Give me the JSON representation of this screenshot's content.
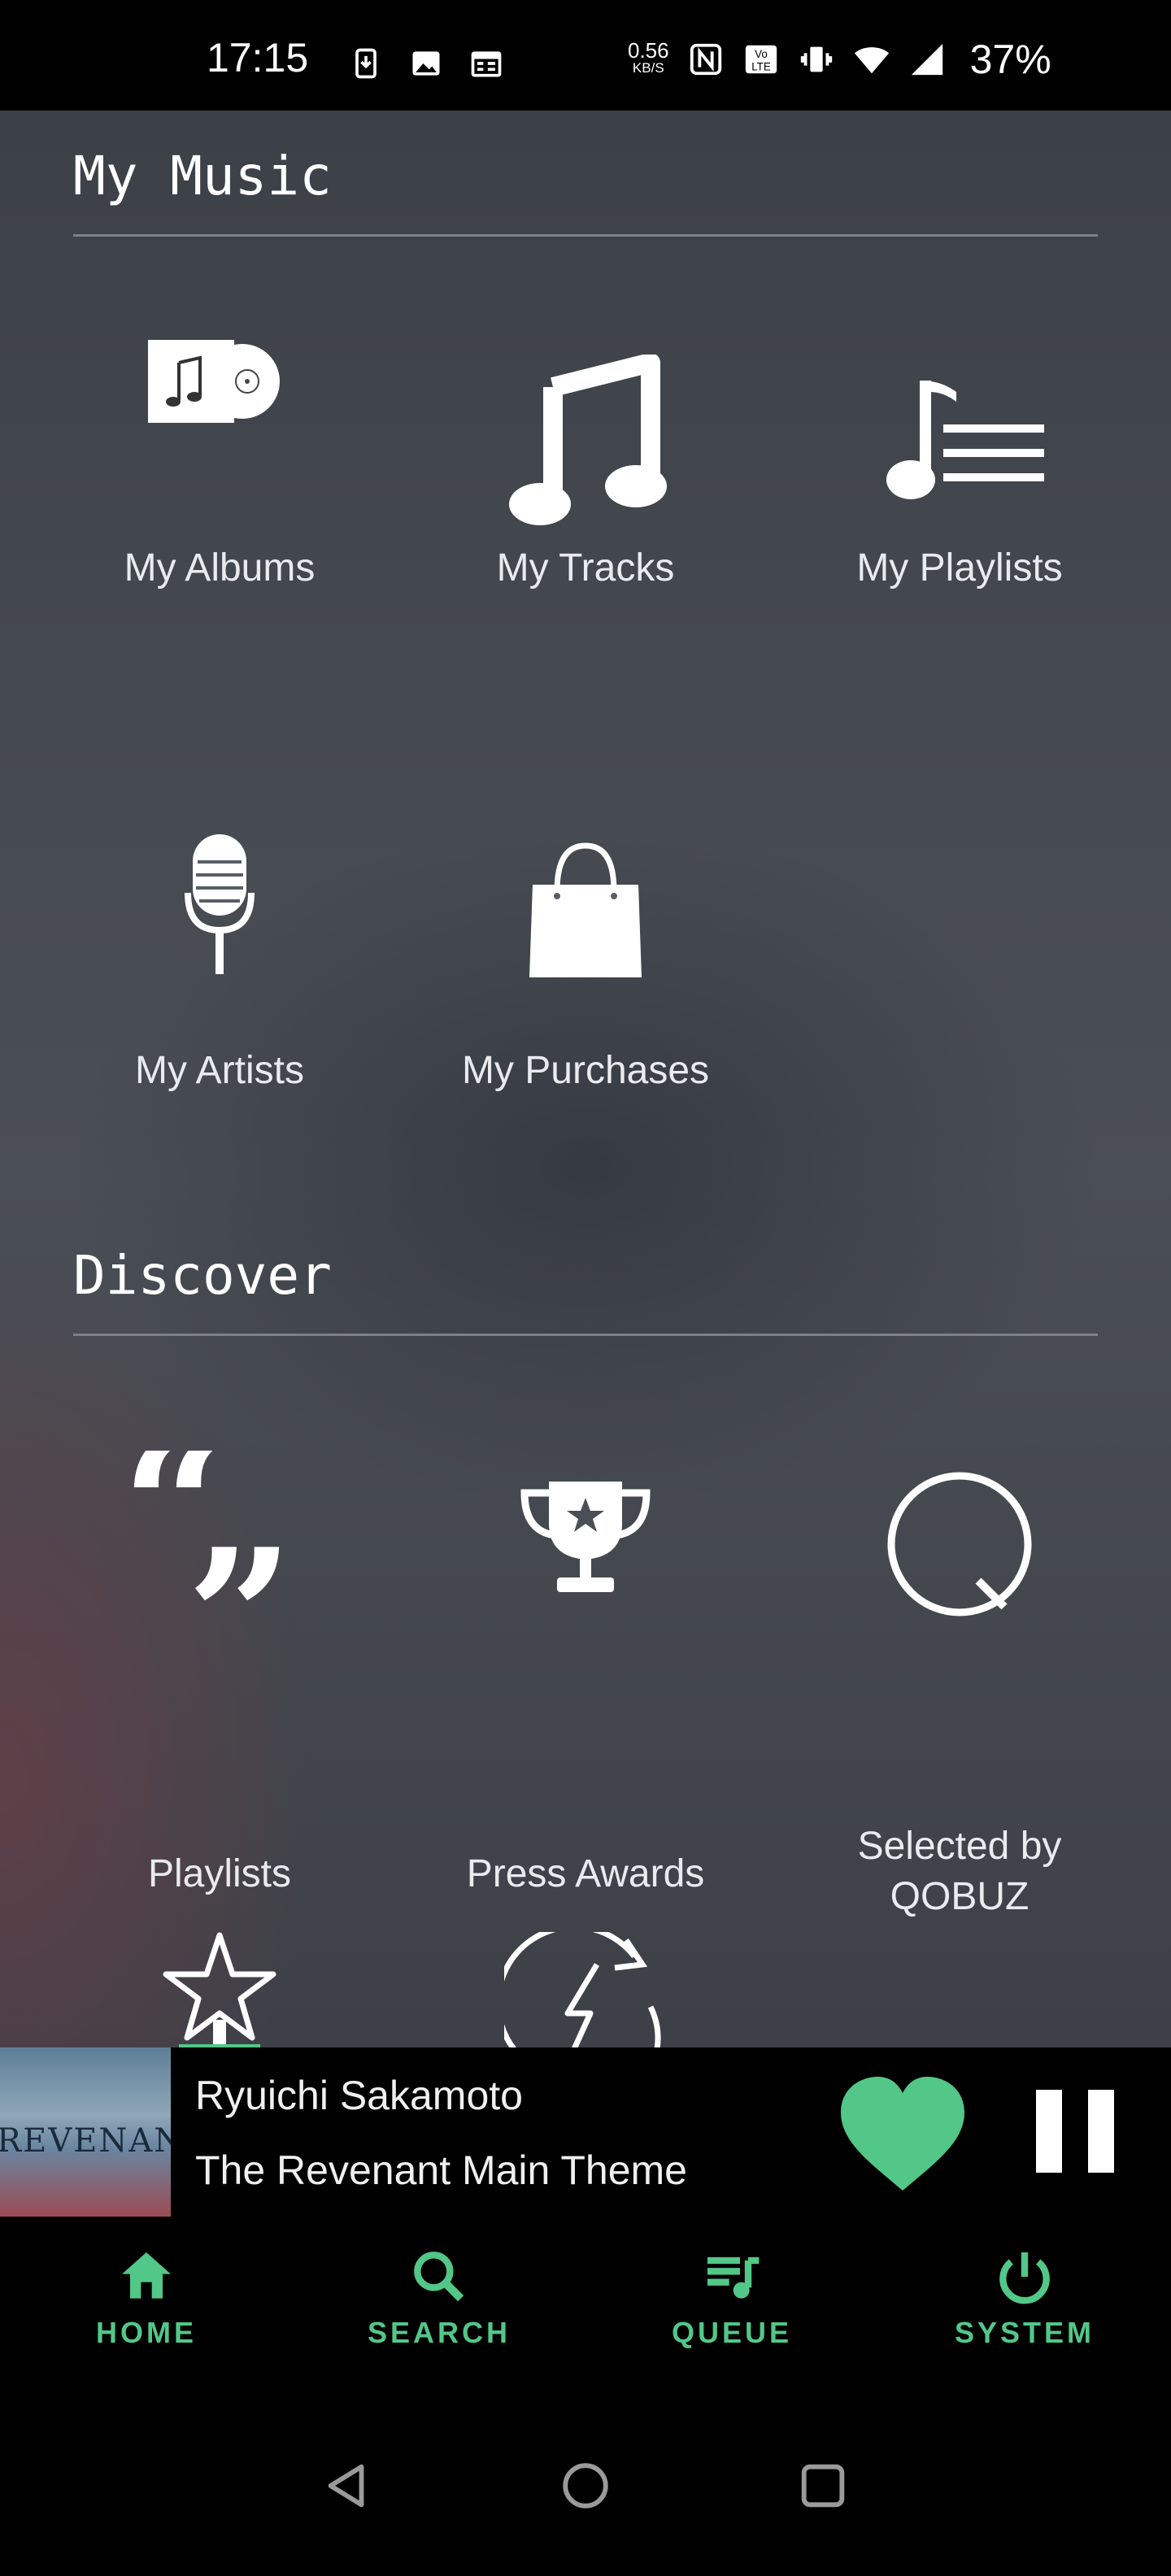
{
  "status_bar": {
    "time": "17:15",
    "net_speed_value": "0.56",
    "net_speed_unit": "KB/S",
    "battery": "37%"
  },
  "sections": {
    "my_music": {
      "title": "My Music",
      "tiles": [
        {
          "label": "My Albums",
          "icon": "album-icon"
        },
        {
          "label": "My Tracks",
          "icon": "music-note-icon"
        },
        {
          "label": "My Playlists",
          "icon": "playlist-icon"
        },
        {
          "label": "My Artists",
          "icon": "microphone-icon"
        },
        {
          "label": "My Purchases",
          "icon": "shopping-bag-icon"
        }
      ]
    },
    "discover": {
      "title": "Discover",
      "tiles": [
        {
          "label": "Playlists",
          "icon": "quote-icon"
        },
        {
          "label": "Press Awards",
          "icon": "trophy-icon"
        },
        {
          "label": "Selected by\nQOBUZ",
          "icon": "qobuz-logo-icon"
        },
        {
          "label": "",
          "icon": "star-icon"
        },
        {
          "label": "",
          "icon": "refresh-lightning-icon"
        }
      ]
    }
  },
  "now_playing": {
    "artist": "Ryuichi Sakamoto",
    "track": "The Revenant Main Theme",
    "album_art_text": "REVENANT",
    "heart_color": "#52c788"
  },
  "bottom_nav": {
    "items": [
      {
        "label": "HOME",
        "icon": "home-icon"
      },
      {
        "label": "SEARCH",
        "icon": "search-icon"
      },
      {
        "label": "QUEUE",
        "icon": "queue-icon"
      },
      {
        "label": "SYSTEM",
        "icon": "power-icon"
      }
    ],
    "accent": "#52c788"
  }
}
